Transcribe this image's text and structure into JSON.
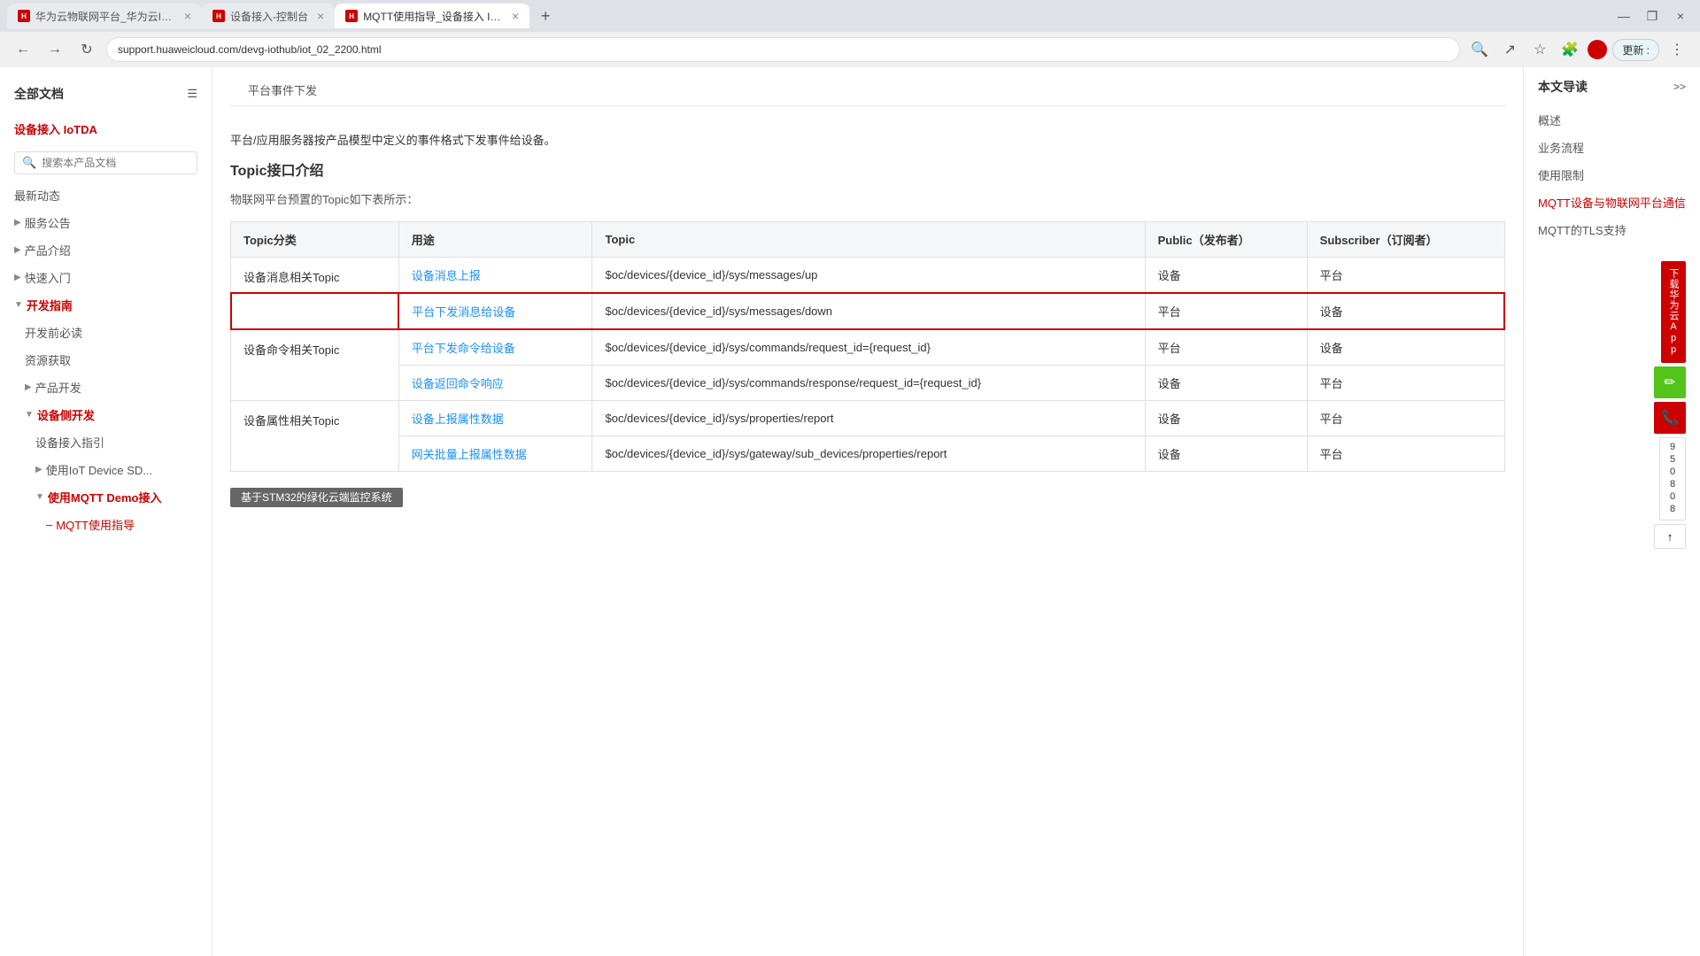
{
  "browser": {
    "tabs": [
      {
        "id": "tab1",
        "favicon": "H",
        "title": "华为云物联网平台_华为云IoT平台...",
        "active": false
      },
      {
        "id": "tab2",
        "favicon": "H",
        "title": "设备接入-控制台",
        "active": false
      },
      {
        "id": "tab3",
        "favicon": "H",
        "title": "MQTT使用指导_设备接入 IoTDA...",
        "active": true
      }
    ],
    "address": "support.huaweicloud.com/devg-iothub/iot_02_2200.html",
    "update_btn": "更新 :"
  },
  "sidebar": {
    "header": "全部文档",
    "section": "设备接入 IoTDA",
    "search_placeholder": "搜索本产品文档",
    "items": [
      {
        "label": "最新动态",
        "level": 0
      },
      {
        "label": "服务公告",
        "level": 0,
        "arrow": "▶"
      },
      {
        "label": "产品介绍",
        "level": 0,
        "arrow": "▶"
      },
      {
        "label": "快速入门",
        "level": 0,
        "arrow": "▶"
      },
      {
        "label": "开发指南",
        "level": 0,
        "arrow": "▼",
        "red": true
      },
      {
        "label": "开发前必读",
        "level": 1
      },
      {
        "label": "资源获取",
        "level": 1
      },
      {
        "label": "产品开发",
        "level": 1,
        "arrow": "▶"
      },
      {
        "label": "设备侧开发",
        "level": 1,
        "arrow": "▼",
        "active": true
      },
      {
        "label": "设备接入指引",
        "level": 2
      },
      {
        "label": "使用IoT Device SD...",
        "level": 2,
        "arrow": "▶"
      },
      {
        "label": "使用MQTT Demo接入",
        "level": 2,
        "arrow": "▼",
        "red": true
      },
      {
        "label": "MQTT使用指导",
        "level": 3,
        "active": true,
        "red": true
      }
    ]
  },
  "top_tabs": [
    {
      "label": "平台事件下发"
    }
  ],
  "tab_desc": "平台/应用服务器按产品模型中定义的事件格式下发事件给设备。",
  "section_title": "Topic接口介绍",
  "section_desc": "物联网平台预置的Topic如下表所示：",
  "table": {
    "headers": [
      "Topic分类",
      "用途",
      "Topic",
      "Public（发布者）",
      "Subscriber（订阅者）"
    ],
    "rows": [
      {
        "category": "设备消息相关Topic",
        "items": [
          {
            "link": "设备消息上报",
            "topic": "$oc/devices/{device_id}/sys/messages/up",
            "pub": "设备",
            "sub": "平台",
            "highlight": false
          },
          {
            "link": "平台下发消息给设备",
            "topic": "$oc/devices/{device_id}/sys/messages/down",
            "pub": "平台",
            "sub": "设备",
            "highlight": true
          }
        ]
      },
      {
        "category": "设备命令相关Topic",
        "items": [
          {
            "link": "平台下发命令给设备",
            "topic": "$oc/devices/{device_id}/sys/commands/request_id={request_id}",
            "pub": "平台",
            "sub": "设备",
            "highlight": false
          },
          {
            "link": "设备返回命令响应",
            "topic": "$oc/devices/{device_id}/sys/commands/response/request_id={request_id}",
            "pub": "设备",
            "sub": "平台",
            "highlight": false
          }
        ]
      },
      {
        "category": "设备属性相关Topic",
        "items": [
          {
            "link": "设备上报属性数据",
            "topic": "$oc/devices/{device_id}/sys/properties/report",
            "pub": "设备",
            "sub": "平台",
            "highlight": false
          },
          {
            "link": "网关批量上报属性数据",
            "topic": "$oc/devices/{device_id}/sys/gateway/sub_devices/properties/report",
            "pub": "设备",
            "sub": "平台",
            "highlight": false
          }
        ]
      }
    ]
  },
  "right_sidebar": {
    "title": "本文导读",
    "items": [
      {
        "label": "概述"
      },
      {
        "label": "业务流程"
      },
      {
        "label": "使用限制"
      },
      {
        "label": "MQTT设备与物联网平台通信",
        "active": true
      },
      {
        "label": "MQTT的TLS支持"
      }
    ],
    "expand_icon": ">>"
  },
  "float_panel": {
    "download_label": "下载华为云App",
    "edit_icon": "✏",
    "phone_icon": "📞",
    "number": "950808",
    "up_icon": "↑"
  },
  "bottom_notification": "基于STM32的绿化云端监控系统"
}
